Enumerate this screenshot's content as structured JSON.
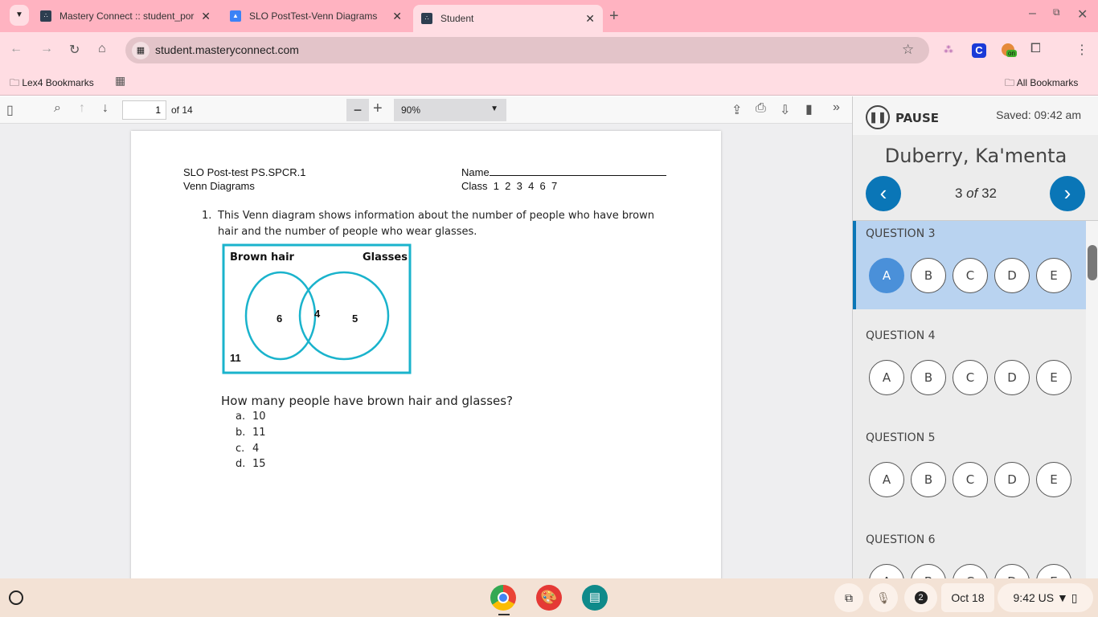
{
  "browser": {
    "tabs": [
      {
        "title": "Mastery Connect :: student_por",
        "active": false
      },
      {
        "title": "SLO PostTest-Venn Diagrams",
        "active": false
      },
      {
        "title": "Student",
        "active": true
      }
    ],
    "url": "student.masteryconnect.com",
    "bookmarks": {
      "folder": "Lex4 Bookmarks",
      "all": "All Bookmarks"
    },
    "extension_badge": "on"
  },
  "pdf": {
    "page": "1",
    "of": "of 14",
    "zoom": "90%"
  },
  "doc": {
    "header_left1": "SLO Post-test PS.SPCR.1",
    "header_left2": "Venn Diagrams",
    "name_label": "Name",
    "class_label": "Class  1  2  3  4  6  7",
    "q_number": "1.",
    "q_text1": "This Venn diagram shows information about the number of people who have brown",
    "q_text2": "hair and the number of people who wear glasses.",
    "venn": {
      "label_left": "Brown hair",
      "label_right": "Glasses",
      "left_only": "6",
      "both": "4",
      "right_only": "5",
      "outside": "11",
      "color": "#1ab3cc"
    },
    "prompt": "How many people have brown hair and glasses?",
    "choices": [
      {
        "letter": "a.",
        "text": "10"
      },
      {
        "letter": "b.",
        "text": "11"
      },
      {
        "letter": "c.",
        "text": "4"
      },
      {
        "letter": "d.",
        "text": "15"
      }
    ]
  },
  "assessment": {
    "pause": "PAUSE",
    "saved": "Saved: 09:42 am",
    "student": "Duberry, Ka'menta",
    "progress_num": "3",
    "progress_of": "of",
    "progress_total": "32",
    "questions": [
      {
        "label": "QUESTION 3",
        "selected": "A"
      },
      {
        "label": "QUESTION 4",
        "selected": null
      },
      {
        "label": "QUESTION 5",
        "selected": null
      },
      {
        "label": "QUESTION 6",
        "selected": null
      }
    ],
    "options": [
      "A",
      "B",
      "C",
      "D",
      "E"
    ],
    "accent": "#0a76b7"
  },
  "shelf": {
    "notifications": "2",
    "date": "Oct 18",
    "time": "9:42",
    "locale": "US"
  }
}
